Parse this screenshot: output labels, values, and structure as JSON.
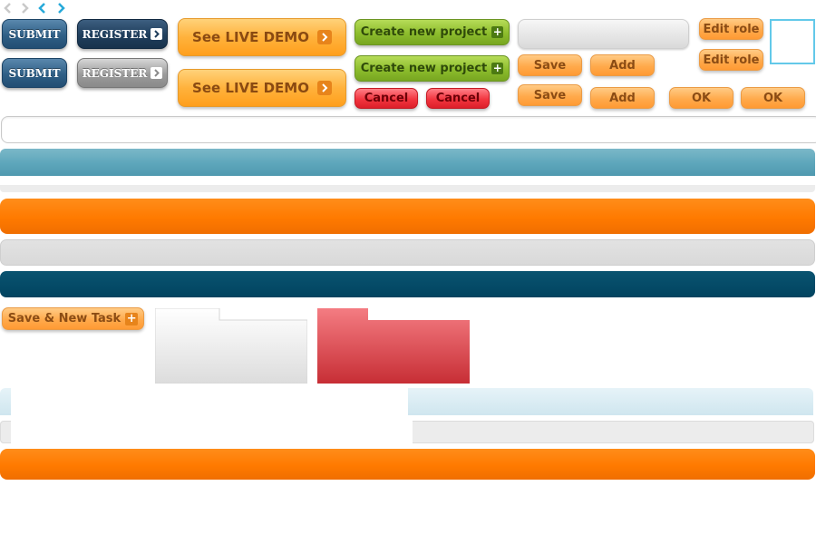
{
  "buttons": {
    "submit": "SUBMIT",
    "register": "REGISTER",
    "see_live_demo": "See LIVE DEMO",
    "create_new_project": "Create new project",
    "cancel": "Cancel",
    "save": "Save",
    "add": "Add",
    "edit_role": "Edit role",
    "ok": "OK",
    "save_new_task": "Save & New Task"
  },
  "icons": [
    "chevron-left-icon",
    "chevron-right-icon",
    "chevron-right-box-icon",
    "plus-box-icon"
  ],
  "colors": {
    "blue_button": "#2f5f86",
    "navy_button": "#1f3e5c",
    "orange": "#ff7a00",
    "green": "#8dbd2d",
    "red": "#f2353f",
    "teal_bar": "#5da6bb",
    "dark_teal_bar": "#014460",
    "light_gray_bar": "#d9d9d9",
    "cyan_border": "#63c9e9"
  }
}
